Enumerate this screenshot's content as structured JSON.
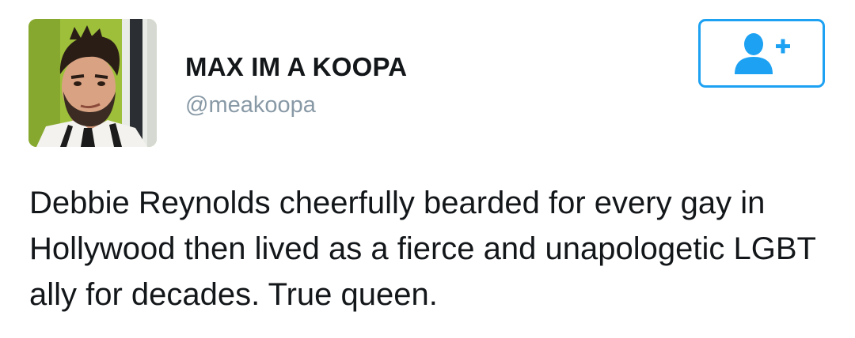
{
  "tweet": {
    "author": {
      "display_name": "MAX IM A KOOPA",
      "handle": "@meakoopa",
      "avatar_icon": "profile-photo"
    },
    "follow_button": {
      "icon": "follow-user-plus-icon",
      "color": "#1da1f2"
    },
    "text": "Debbie Reynolds cheerfully bearded for every gay in Hollywood then lived as a fierce and unapologetic LGBT ally for decades. True queen."
  }
}
